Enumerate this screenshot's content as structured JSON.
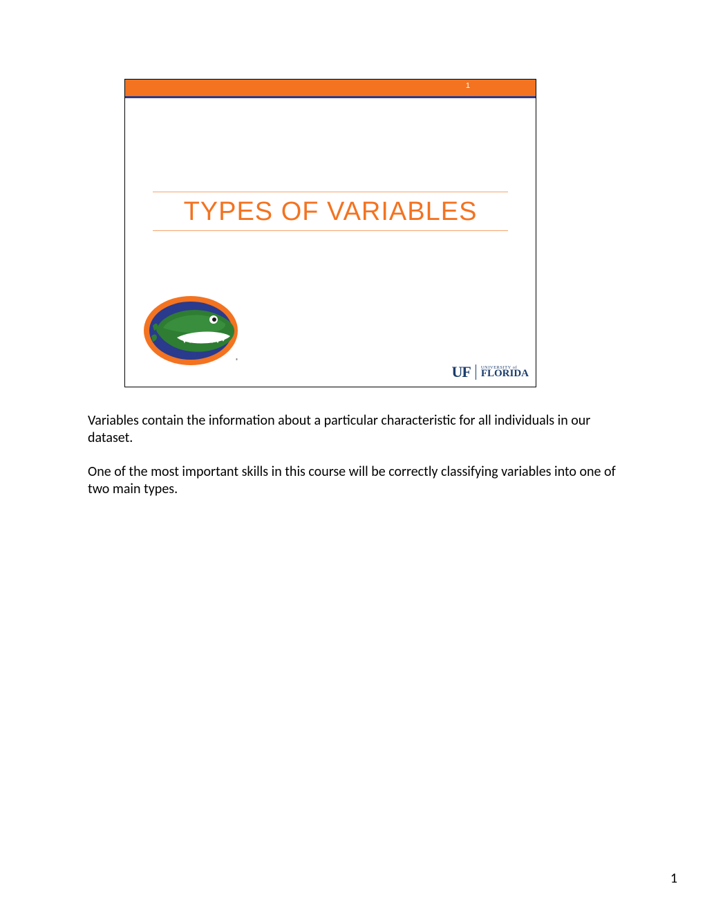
{
  "slide": {
    "number": "1",
    "title": "TYPES OF VARIABLES",
    "logo_uf_big": "UF",
    "logo_uf_small": "UNIVERSITY of",
    "logo_uf_florida": "FLORIDA",
    "colors": {
      "orange": "#f37321",
      "blue": "#2a3a8c",
      "uf_navy": "#1b3d6d"
    }
  },
  "notes": {
    "p1": "Variables contain the information about a particular characteristic for all individuals in our dataset.",
    "p2": "One of the most important skills in this course will be correctly classifying variables into one of two main types."
  },
  "page_number": "1"
}
